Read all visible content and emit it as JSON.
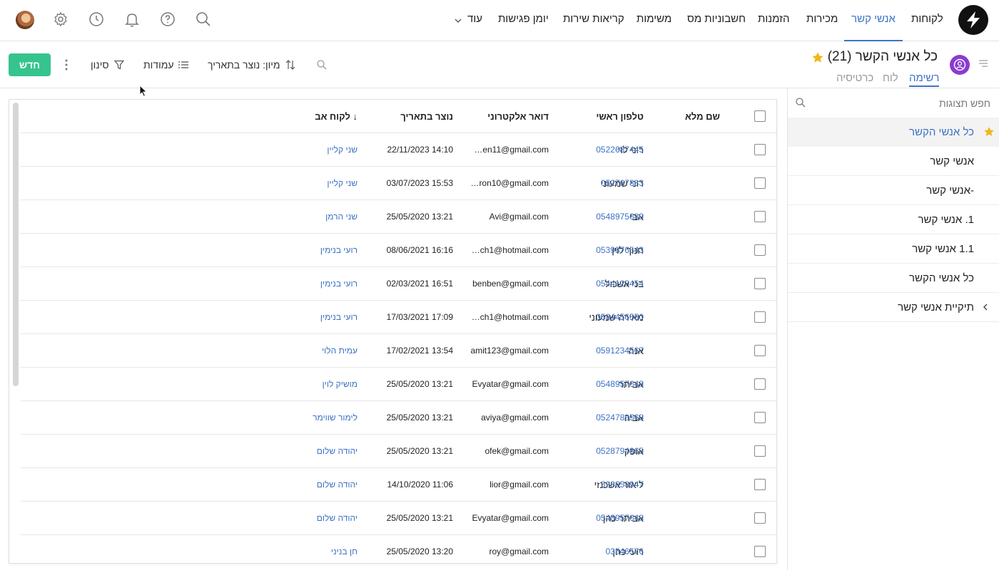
{
  "nav": {
    "items": [
      {
        "label": "לקוחות",
        "active": false
      },
      {
        "label": "אנשי קשר",
        "active": true
      },
      {
        "label": "מכירות",
        "active": false
      },
      {
        "label": "הזמנות",
        "active": false
      },
      {
        "label": "חשבוניות מס",
        "active": false
      },
      {
        "label": "משימות",
        "active": false
      },
      {
        "label": "קריאות שירות",
        "active": false
      },
      {
        "label": "יומן פגישות",
        "active": false
      },
      {
        "label": "עוד",
        "active": false
      }
    ],
    "icons": [
      "search-icon",
      "help-icon",
      "bell-icon",
      "clock-icon",
      "gear-icon",
      "user-avatar"
    ]
  },
  "header": {
    "title": "כל אנשי הקשר (21)",
    "view_tabs": [
      {
        "label": "רשימה",
        "active": true
      },
      {
        "label": "לוח",
        "active": false
      },
      {
        "label": "כרטיסיה",
        "active": false
      }
    ]
  },
  "toolbar": {
    "new_label": "חדש",
    "filter_label": "סינון",
    "columns_label": "עמודות",
    "sort_label": "מיון: נוצר בתאריך"
  },
  "sidebar": {
    "search_placeholder": "חפש תצוגות",
    "items": [
      {
        "label": "כל אנשי הקשר",
        "active": true,
        "starred": true
      },
      {
        "label": "אנשי קשר",
        "active": false
      },
      {
        "label": "-אנשי קשר",
        "active": false
      },
      {
        "label": "1. אנשי קשר",
        "active": false
      },
      {
        "label": "1.1 אנשי קשר",
        "active": false
      },
      {
        "label": "כל אנשי הקשר",
        "active": false
      },
      {
        "label": "תיקיית אנשי קשר",
        "active": false,
        "folder": true
      }
    ]
  },
  "table": {
    "columns": {
      "name": "שם מלא",
      "phone": "טלפון ראשי",
      "email": "דואר אלקטרוני",
      "created": "נוצר בתאריך",
      "parent": "↓ לקוח אב"
    },
    "rows": [
      {
        "name": "רוני לוי",
        "phone": "0522687445",
        "email": "…en11@gmail.com",
        "created": "22/11/2023 14:10",
        "parent": "שני קליין"
      },
      {
        "name": "רוני שמעוני",
        "phone": "052767883",
        "email": "…ron10@gmail.com",
        "created": "03/07/2023 15:53",
        "parent": "שני קליין"
      },
      {
        "name": "אבי",
        "phone": "0548975689",
        "email": "Avi@gmail.com",
        "created": "25/05/2020 13:21",
        "parent": "שני הרמן"
      },
      {
        "name": "חנוך לוין",
        "phone": "0539876543",
        "email": "…ch1@hotmail.com",
        "created": "08/06/2021 16:16",
        "parent": "רועי בנימין"
      },
      {
        "name": "בני אשכול",
        "phone": "0544123454",
        "email": "benben@gmail.com",
        "created": "02/03/2021 16:51",
        "parent": "רועי בנימין"
      },
      {
        "name": "מאירה שמעוני",
        "phone": "0584456550",
        "email": "…ch1@hotmail.com",
        "created": "17/03/2021 17:09",
        "parent": "רועי בנימין"
      },
      {
        "name": "אנה",
        "phone": "0591234567",
        "email": "amit123@gmail.com",
        "created": "17/02/2021 13:54",
        "parent": "עמית הלוי"
      },
      {
        "name": "אביתר",
        "phone": "0548957648",
        "email": "Evyatar@gmail.com",
        "created": "25/05/2020 13:21",
        "parent": "מושיק לוין"
      },
      {
        "name": "אביה",
        "phone": "0524789568",
        "email": "aviya@gmail.com",
        "created": "25/05/2020 13:21",
        "parent": "לימור שווימר"
      },
      {
        "name": "אופק",
        "phone": "0528794865",
        "email": "ofek@gmail.com",
        "created": "25/05/2020 13:21",
        "parent": "יהודה שלום"
      },
      {
        "name": "ליאור אשכנזי",
        "phone": "523658947",
        "email": "lior@gmail.com",
        "created": "14/10/2020 11:06",
        "parent": "יהודה שלום"
      },
      {
        "name": "אביתר כהן",
        "phone": "0548957648",
        "email": "Evyatar@gmail.com",
        "created": "25/05/2020 13:21",
        "parent": "יהודה שלום"
      },
      {
        "name": "רועי כהן",
        "phone": "03546576",
        "email": "roy@gmail.com",
        "created": "25/05/2020 13:20",
        "parent": "חן בניני"
      }
    ]
  },
  "colors": {
    "accent": "#3d72c4",
    "new_button": "#35c48d",
    "view_icon": "#8a3bd1",
    "star": "#f2b519"
  }
}
